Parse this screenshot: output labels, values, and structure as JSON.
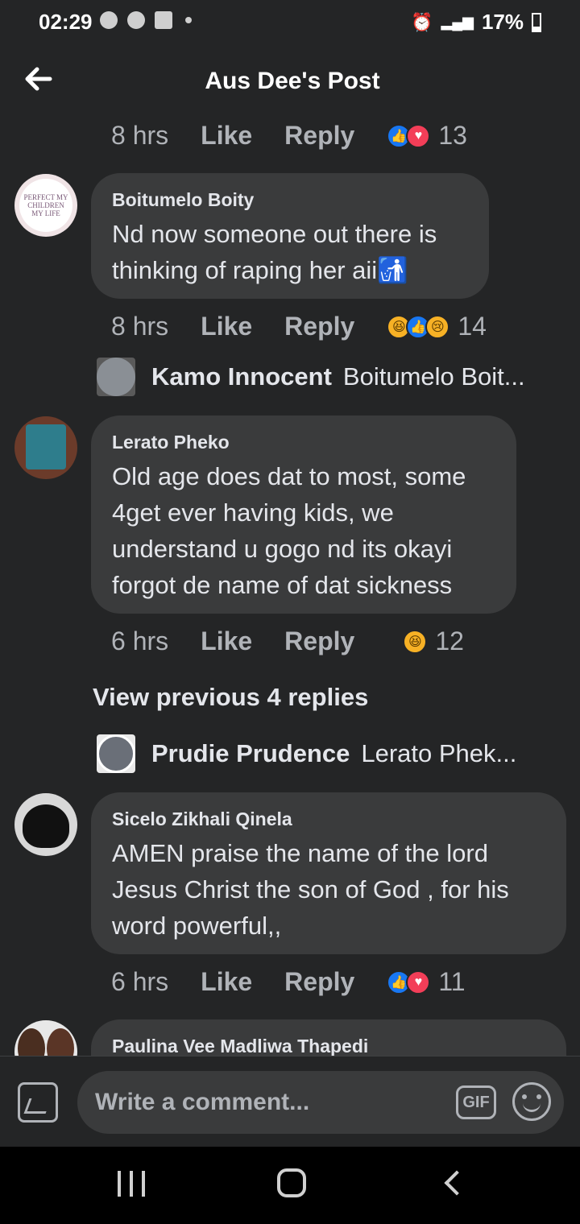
{
  "status": {
    "time": "02:29",
    "battery": "17%"
  },
  "header": {
    "title": "Aus Dee's Post"
  },
  "top_meta": {
    "time": "8 hrs",
    "like": "Like",
    "reply": "Reply",
    "count": "13"
  },
  "comments": [
    {
      "author": "Boitumelo Boity",
      "lines": [
        "Nd now someone out there is",
        "thinking of raping her aii🚮"
      ],
      "time": "8 hrs",
      "like": "Like",
      "reply": "Reply",
      "count": "14",
      "avatar_text": "PERFECT MY CHILDREN MY LIFE"
    },
    {
      "author": "Lerato Pheko",
      "lines": [
        "Old age does dat to most, some",
        "4get ever having kids, we",
        "understand u gogo nd its okayi",
        "forgot de name of dat sickness"
      ],
      "time": "6 hrs",
      "like": "Like",
      "reply": "Reply",
      "count": "12"
    },
    {
      "author": "Sicelo Zikhali Qinela",
      "lines": [
        "AMEN praise the name of the lord",
        "Jesus Christ the son of God , for his",
        "word powerful,,"
      ],
      "time": "6 hrs",
      "like": "Like",
      "reply": "Reply",
      "count": "11"
    },
    {
      "author": "Paulina Vee Madliwa Thapedi"
    }
  ],
  "replies": [
    {
      "name": "Kamo Innocent",
      "snippet": "Boitumelo Boit..."
    },
    {
      "name": "Prudie Prudence",
      "snippet": "Lerato Phek..."
    }
  ],
  "view_previous": "View previous 4 replies",
  "composer": {
    "placeholder": "Write a comment...",
    "gif": "GIF"
  },
  "colors": {
    "background": "#242526",
    "bubble": "#3a3b3c",
    "text": "#e4e6eb",
    "muted": "#b0b3b8",
    "like": "#1877f2",
    "love": "#f33e58"
  }
}
